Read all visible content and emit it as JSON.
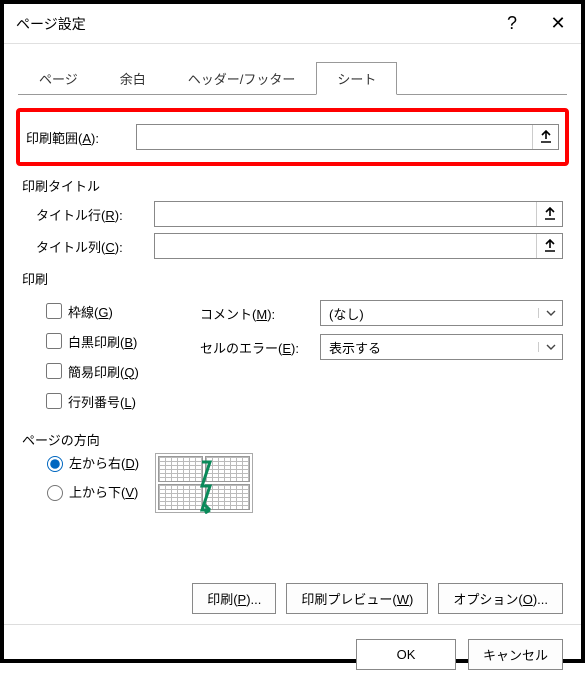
{
  "window": {
    "title": "ページ設定"
  },
  "tabs": {
    "page": "ページ",
    "margins": "余白",
    "headerfooter": "ヘッダー/フッター",
    "sheet": "シート"
  },
  "labels": {
    "printArea": "印刷範囲(A):",
    "printTitles": "印刷タイトル",
    "titleRows": "タイトル行(R):",
    "titleCols": "タイトル列(C):",
    "printSection": "印刷",
    "gridlines": "枠線(G)",
    "blackWhite": "白黒印刷(B)",
    "draft": "簡易印刷(Q)",
    "rowColHead": "行列番号(L)",
    "comments": "コメント(M):",
    "cellErrors": "セルのエラー(E):",
    "pageOrder": "ページの方向",
    "overDown": "左から右(D)",
    "downOver": "上から下(V)"
  },
  "values": {
    "printArea": "",
    "titleRows": "",
    "titleCols": "",
    "comments": "(なし)",
    "cellErrors": "表示する"
  },
  "buttons": {
    "print": "印刷(P)...",
    "preview": "印刷プレビュー(W)",
    "options": "オプション(O)...",
    "ok": "OK",
    "cancel": "キャンセル"
  }
}
